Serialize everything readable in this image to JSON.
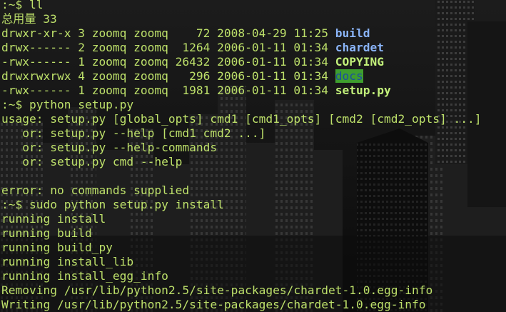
{
  "terminal": {
    "lines": [
      {
        "kind": "prompt",
        "text": ":~$ ll"
      },
      {
        "kind": "plain",
        "text": "总用量 33"
      },
      {
        "kind": "ls",
        "meta": "drwxr-xr-x 3 zoomq zoomq    72 2008-04-29 11:25 ",
        "name": "build",
        "style": "dir"
      },
      {
        "kind": "ls",
        "meta": "drwx------ 2 zoomq zoomq  1264 2006-01-11 01:34 ",
        "name": "chardet",
        "style": "dir"
      },
      {
        "kind": "ls",
        "meta": "-rwx------ 1 zoomq zoomq 26432 2006-01-11 01:34 ",
        "name": "COPYING",
        "style": "exe"
      },
      {
        "kind": "ls",
        "meta": "drwxrwxrwx 4 zoomq zoomq   296 2006-01-11 01:34 ",
        "name": "docs",
        "style": "sticky"
      },
      {
        "kind": "ls",
        "meta": "-rwx------ 1 zoomq zoomq  1981 2006-01-11 01:34 ",
        "name": "setup.py",
        "style": "exe"
      },
      {
        "kind": "prompt",
        "text": ":~$ python setup.py"
      },
      {
        "kind": "plain",
        "text": "usage: setup.py [global_opts] cmd1 [cmd1_opts] [cmd2 [cmd2_opts] ...]"
      },
      {
        "kind": "plain",
        "text": "   or: setup.py --help [cmd1 cmd2 ...]"
      },
      {
        "kind": "plain",
        "text": "   or: setup.py --help-commands"
      },
      {
        "kind": "plain",
        "text": "   or: setup.py cmd --help"
      },
      {
        "kind": "plain",
        "text": ""
      },
      {
        "kind": "plain",
        "text": "error: no commands supplied"
      },
      {
        "kind": "prompt",
        "text": ":~$ sudo python setup.py install"
      },
      {
        "kind": "plain",
        "text": "running install"
      },
      {
        "kind": "plain",
        "text": "running build"
      },
      {
        "kind": "plain",
        "text": "running build_py"
      },
      {
        "kind": "plain",
        "text": "running install_lib"
      },
      {
        "kind": "plain",
        "text": "running install_egg_info"
      },
      {
        "kind": "plain",
        "text": "Removing /usr/lib/python2.5/site-packages/chardet-1.0.egg-info"
      },
      {
        "kind": "plain",
        "text": "Writing /usr/lib/python2.5/site-packages/chardet-1.0.egg-info"
      }
    ]
  },
  "colors": {
    "text": "#bde06a",
    "directory": "#8ab4f8",
    "executable": "#c2f07a",
    "sticky_fg": "#1d4f9e",
    "sticky_bg": "#3e9e2e",
    "background": "#111111"
  }
}
